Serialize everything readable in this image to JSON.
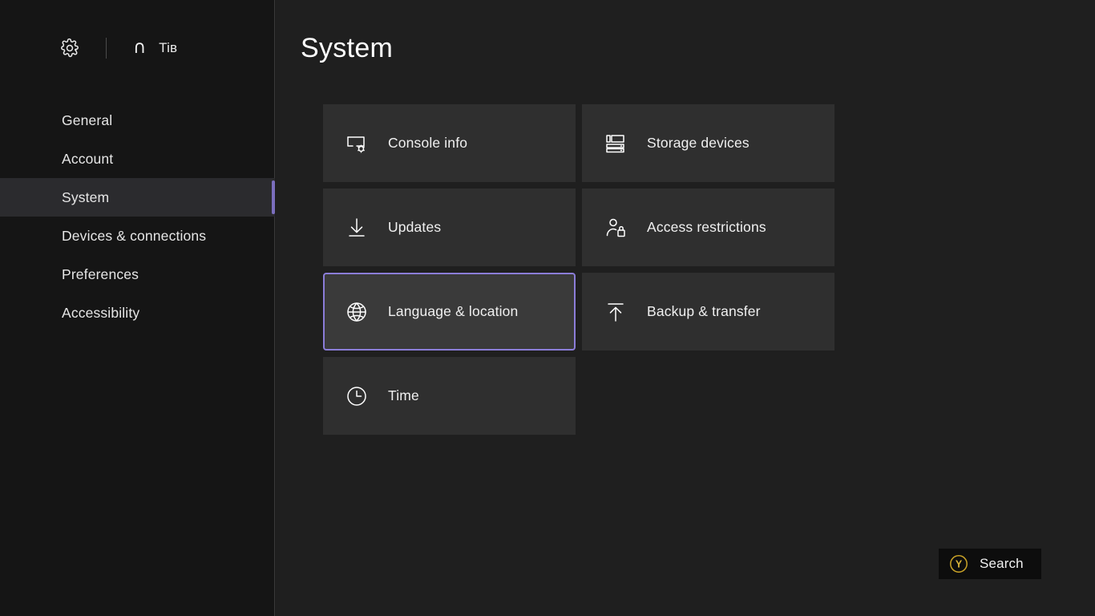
{
  "sidebar": {
    "gear_icon": "gear-icon",
    "profile_glyph": "∩",
    "profile_name": "Tiʙ",
    "items": [
      {
        "label": "General",
        "selected": false
      },
      {
        "label": "Account",
        "selected": false
      },
      {
        "label": "System",
        "selected": true
      },
      {
        "label": "Devices & connections",
        "selected": false
      },
      {
        "label": "Preferences",
        "selected": false
      },
      {
        "label": "Accessibility",
        "selected": false
      }
    ]
  },
  "main": {
    "title": "System",
    "tiles": [
      {
        "label": "Console info",
        "icon": "console-info-icon",
        "focused": false
      },
      {
        "label": "Storage devices",
        "icon": "storage-devices-icon",
        "focused": false
      },
      {
        "label": "Updates",
        "icon": "download-arrow-icon",
        "focused": false
      },
      {
        "label": "Access restrictions",
        "icon": "person-lock-icon",
        "focused": false
      },
      {
        "label": "Language & location",
        "icon": "globe-icon",
        "focused": true
      },
      {
        "label": "Backup & transfer",
        "icon": "upload-arrow-icon",
        "focused": false
      },
      {
        "label": "Time",
        "icon": "clock-icon",
        "focused": false
      }
    ]
  },
  "footer": {
    "search_label": "Search",
    "search_button_glyph": "Y"
  },
  "colors": {
    "focus_border": "#8b7dd8",
    "nav_accent": "#7b6ebd",
    "tile_background": "#2f2f2f",
    "tile_background_focused": "#3a3a3a",
    "sidebar_background": "#151515",
    "main_background": "#1f1f1f",
    "y_button": "#c9a227"
  }
}
